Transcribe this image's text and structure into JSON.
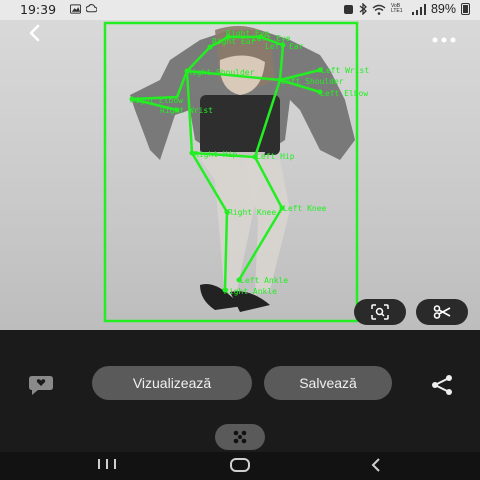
{
  "status_bar": {
    "time": "19:39",
    "network": "VoB LTE1",
    "battery": "89%"
  },
  "top_bar": {
    "back_icon": "chevron-left-icon",
    "more_icon": "more-horizontal-icon"
  },
  "pose_overlay": {
    "color": "#22ee22",
    "labels": {
      "right_eye": "Right Eye",
      "left_eye": "Left Eye",
      "left_ear": "Left Ear",
      "right_ear": "Right Ear",
      "right_shoulder": "Right Shoulder",
      "left_shoulder": "Left Shoulder",
      "left_wrist": "Left Wrist",
      "left_elbow": "Left Elbow",
      "right_elbow": "Right Elbow",
      "right_wrist": "Right Wrist",
      "right_hip": "Right Hip",
      "left_hip": "Left Hip",
      "right_knee": "Right Knee",
      "left_knee": "Left Knee",
      "left_ankle": "Left Ankle",
      "right_ankle": "Right Ankle"
    }
  },
  "actions": {
    "view_label": "Vizualizează",
    "save_label": "Salvează",
    "lens_icon": "lens-search-icon",
    "cut_icon": "scissors-icon",
    "comment_icon": "comment-heart-icon",
    "share_icon": "share-icon",
    "more_icon": "dots-more-icon"
  },
  "nav_bar": {
    "recents_icon": "recents-icon",
    "home_icon": "home-icon",
    "back_icon": "nav-back-icon"
  }
}
